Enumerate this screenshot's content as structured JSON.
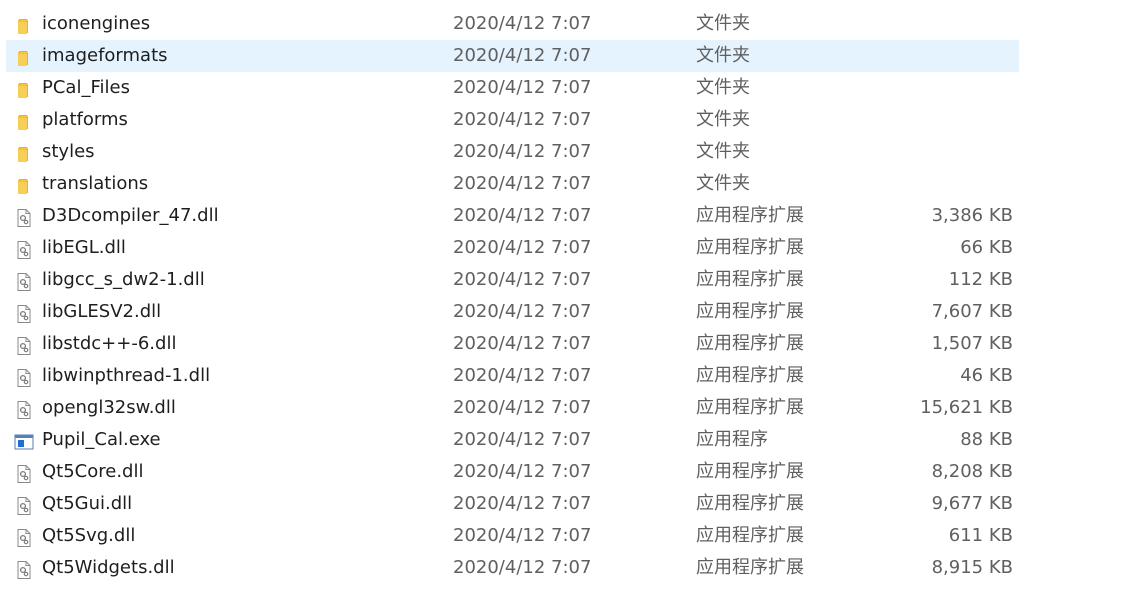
{
  "files": [
    {
      "name": "iconengines",
      "date": "2020/4/12 7:07",
      "type": "文件夹",
      "size": "",
      "icon": "folder-icon"
    },
    {
      "name": "imageformats",
      "date": "2020/4/12 7:07",
      "type": "文件夹",
      "size": "",
      "icon": "folder-icon",
      "selected": true
    },
    {
      "name": "PCal_Files",
      "date": "2020/4/12 7:07",
      "type": "文件夹",
      "size": "",
      "icon": "folder-icon"
    },
    {
      "name": "platforms",
      "date": "2020/4/12 7:07",
      "type": "文件夹",
      "size": "",
      "icon": "folder-icon"
    },
    {
      "name": "styles",
      "date": "2020/4/12 7:07",
      "type": "文件夹",
      "size": "",
      "icon": "folder-icon"
    },
    {
      "name": "translations",
      "date": "2020/4/12 7:07",
      "type": "文件夹",
      "size": "",
      "icon": "folder-icon"
    },
    {
      "name": "D3Dcompiler_47.dll",
      "date": "2020/4/12 7:07",
      "type": "应用程序扩展",
      "size": "3,386 KB",
      "icon": "dll-file-icon"
    },
    {
      "name": "libEGL.dll",
      "date": "2020/4/12 7:07",
      "type": "应用程序扩展",
      "size": "66 KB",
      "icon": "dll-file-icon"
    },
    {
      "name": "libgcc_s_dw2-1.dll",
      "date": "2020/4/12 7:07",
      "type": "应用程序扩展",
      "size": "112 KB",
      "icon": "dll-file-icon"
    },
    {
      "name": "libGLESV2.dll",
      "date": "2020/4/12 7:07",
      "type": "应用程序扩展",
      "size": "7,607 KB",
      "icon": "dll-file-icon"
    },
    {
      "name": "libstdc++-6.dll",
      "date": "2020/4/12 7:07",
      "type": "应用程序扩展",
      "size": "1,507 KB",
      "icon": "dll-file-icon"
    },
    {
      "name": "libwinpthread-1.dll",
      "date": "2020/4/12 7:07",
      "type": "应用程序扩展",
      "size": "46 KB",
      "icon": "dll-file-icon"
    },
    {
      "name": "opengl32sw.dll",
      "date": "2020/4/12 7:07",
      "type": "应用程序扩展",
      "size": "15,621 KB",
      "icon": "dll-file-icon"
    },
    {
      "name": "Pupil_Cal.exe",
      "date": "2020/4/12 7:07",
      "type": "应用程序",
      "size": "88 KB",
      "icon": "exe-file-icon"
    },
    {
      "name": "Qt5Core.dll",
      "date": "2020/4/12 7:07",
      "type": "应用程序扩展",
      "size": "8,208 KB",
      "icon": "dll-file-icon"
    },
    {
      "name": "Qt5Gui.dll",
      "date": "2020/4/12 7:07",
      "type": "应用程序扩展",
      "size": "9,677 KB",
      "icon": "dll-file-icon"
    },
    {
      "name": "Qt5Svg.dll",
      "date": "2020/4/12 7:07",
      "type": "应用程序扩展",
      "size": "611 KB",
      "icon": "dll-file-icon"
    },
    {
      "name": "Qt5Widgets.dll",
      "date": "2020/4/12 7:07",
      "type": "应用程序扩展",
      "size": "8,915 KB",
      "icon": "dll-file-icon"
    }
  ],
  "colors": {
    "selected_row": "#e5f3ff",
    "folder": "#f2c94c",
    "exe_icon": "#1f6fd1"
  }
}
